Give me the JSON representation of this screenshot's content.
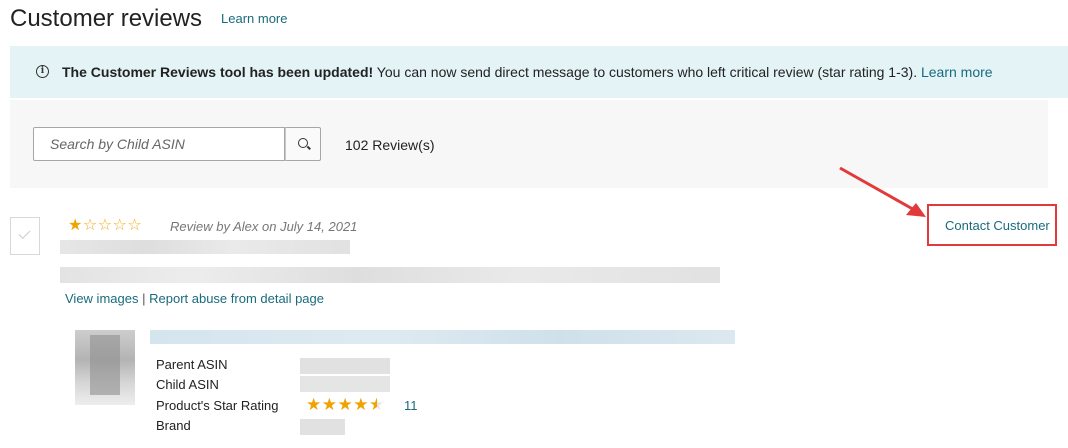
{
  "header": {
    "title": "Customer reviews",
    "learn_more": "Learn more"
  },
  "banner": {
    "icon": "info-icon",
    "bold_text": "The Customer Reviews tool has been updated!",
    "text": " You can now send direct message to customers who left critical review (star rating 1-3). ",
    "link": "Learn more",
    "background": "#e4f3f6"
  },
  "search": {
    "placeholder": "Search by Child ASIN",
    "button_icon": "search-icon",
    "count": "102 Review(s)"
  },
  "review": {
    "stars_filled": 1,
    "stars_total": 5,
    "byline": "Review by Alex on July 14, 2021",
    "view_images": "View images",
    "separator": "|",
    "report_abuse": "Report abuse from detail page",
    "contact_customer": "Contact Customer"
  },
  "product": {
    "labels": {
      "parent_asin": "Parent ASIN",
      "child_asin": "Child ASIN",
      "star_rating": "Product's Star Rating",
      "brand": "Brand"
    },
    "rating_value": 4.5,
    "rating_count": "11"
  },
  "colors": {
    "accent_link": "#1a6b7c",
    "star": "#f0a300",
    "highlight_red": "#e23a3a"
  }
}
